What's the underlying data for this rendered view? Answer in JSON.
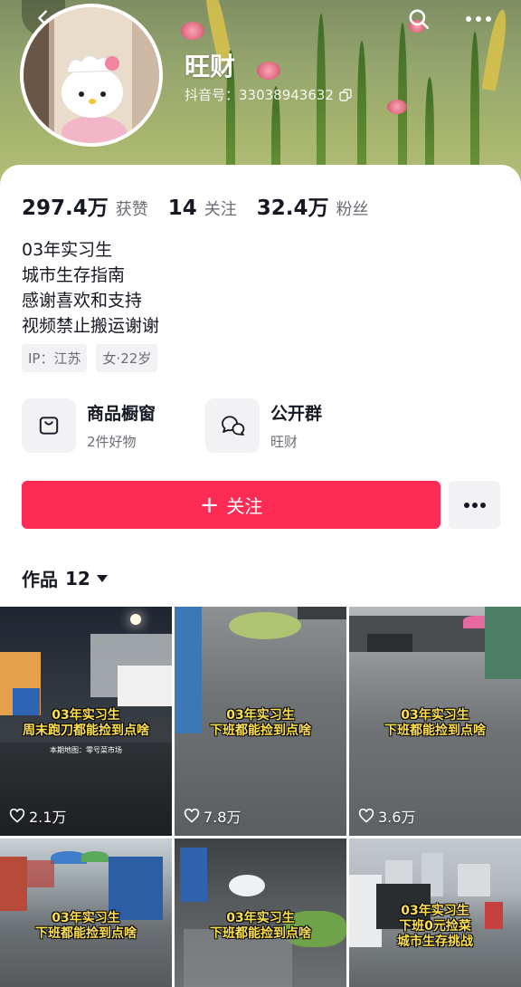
{
  "profile": {
    "name": "旺财",
    "douyin_id": "抖音号：33038943632",
    "bio_lines": [
      "03年实习生",
      "城市生存指南",
      "感谢喜欢和支持",
      "视频禁止搬运谢谢"
    ],
    "tags": [
      "IP：江苏",
      "女·22岁"
    ]
  },
  "stats": [
    {
      "value": "297.4万",
      "label": "获赞"
    },
    {
      "value": "14",
      "label": "关注"
    },
    {
      "value": "32.4万",
      "label": "粉丝"
    }
  ],
  "shortcuts": [
    {
      "title": "商品橱窗",
      "subtitle": "2件好物",
      "icon": "shop-bag-icon"
    },
    {
      "title": "公开群",
      "subtitle": "旺财",
      "icon": "group-chat-icon"
    }
  ],
  "actions": {
    "follow_label": "关注"
  },
  "works": {
    "label": "作品",
    "count": "12"
  },
  "videos": [
    {
      "caption": [
        "03年实习生",
        "周末跑刀都能捡到点啥"
      ],
      "sub_caption": "本期地图：零号菜市场",
      "likes": "2.1万"
    },
    {
      "caption": [
        "03年实习生",
        "下班都能捡到点啥"
      ],
      "likes": "7.8万"
    },
    {
      "caption": [
        "03年实习生",
        "下班都能捡到点啥"
      ],
      "likes": "3.6万"
    },
    {
      "caption": [
        "03年实习生",
        "下班都能捡到点啥"
      ]
    },
    {
      "caption": [
        "03年实习生",
        "下班都能捡到点啥"
      ]
    },
    {
      "caption": [
        "03年实习生",
        "下班0元捡菜",
        "城市生存挑战"
      ]
    }
  ],
  "colors": {
    "accent": "#fe2c55",
    "text": "#161823",
    "secondary_text": "#6b6d75",
    "chip_bg": "#f2f2f4",
    "caption": "#ffe14d"
  }
}
